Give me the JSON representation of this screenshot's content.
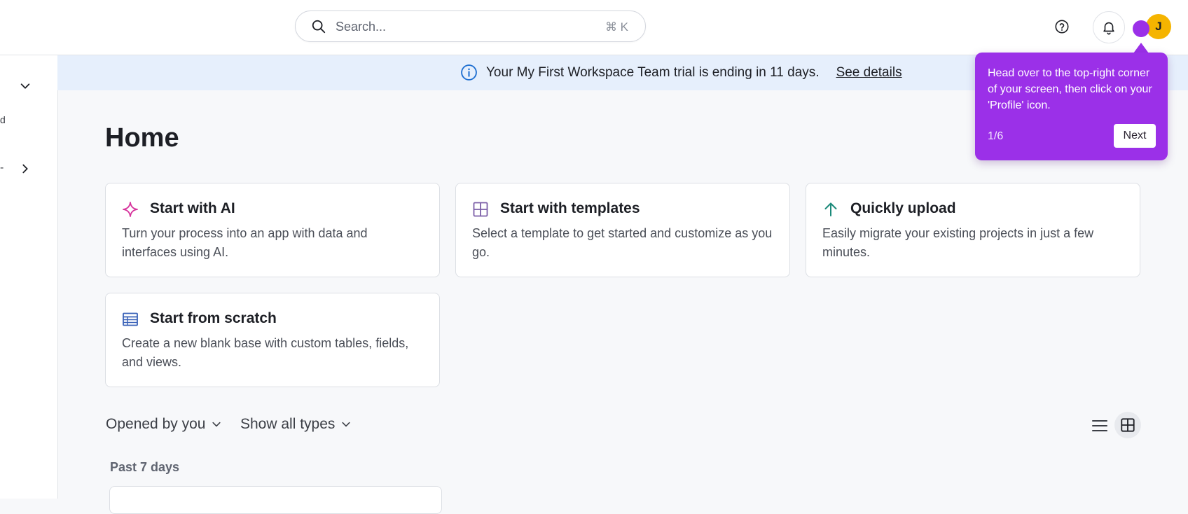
{
  "header": {
    "search_placeholder": "Search...",
    "search_shortcut": "⌘ K",
    "avatar_initial": "J"
  },
  "sidebar": {
    "partial_text": "d",
    "partial_dash": "-"
  },
  "banner": {
    "message": "Your My First Workspace Team trial is ending in 11 days.",
    "link_label": "See details"
  },
  "main": {
    "title": "Home",
    "cards": [
      {
        "title": "Start with AI",
        "description": "Turn your process into an app with data and interfaces using AI.",
        "icon": "sparkle-icon"
      },
      {
        "title": "Start with templates",
        "description": "Select a template to get started and customize as you go.",
        "icon": "grid-icon"
      },
      {
        "title": "Quickly upload",
        "description": "Easily migrate your existing projects in just a few minutes.",
        "icon": "arrow-up-icon"
      },
      {
        "title": "Start from scratch",
        "description": "Create a new blank base with custom tables, fields, and views.",
        "icon": "table-icon"
      }
    ],
    "filters": {
      "opened_by": "Opened by you",
      "types": "Show all types"
    },
    "section_label": "Past 7 days"
  },
  "tooltip": {
    "text": "Head over to the top-right corner of your screen, then click on your 'Profile' icon.",
    "step": "1/6",
    "next_label": "Next"
  },
  "colors": {
    "tooltip_bg": "#9b30e8",
    "avatar_bg": "#f5b400",
    "banner_bg": "#e6effc",
    "ai_icon": "#d6339c",
    "templates_icon": "#7b5ea7",
    "upload_icon": "#1c8a7a",
    "scratch_icon": "#3a62b8"
  }
}
